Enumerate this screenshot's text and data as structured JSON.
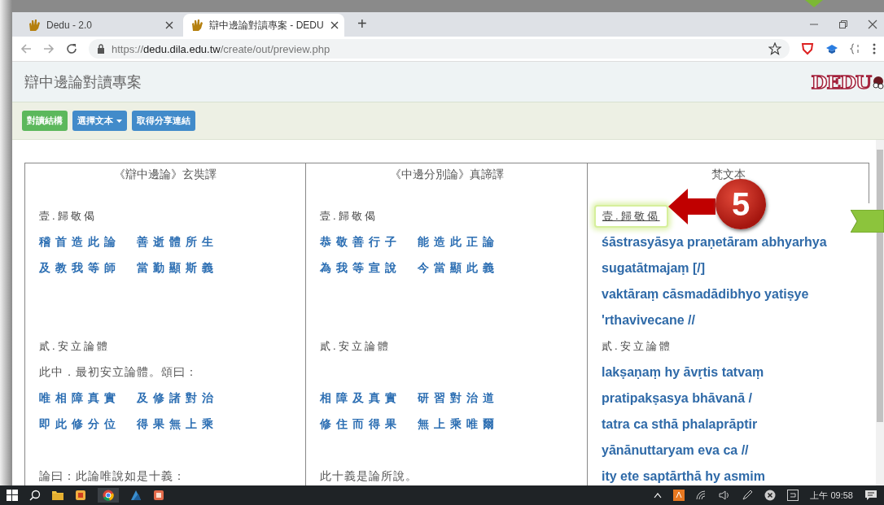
{
  "browser": {
    "tabs": [
      {
        "title": "Dedu - 2.0",
        "selected": false
      },
      {
        "title": "辯中邊論對讀專案 - DEDU",
        "selected": true
      }
    ],
    "new_tab": "+",
    "url": {
      "scheme": "https://",
      "host": "dedu.dila.edu.tw",
      "path": "/create/out/preview.php"
    }
  },
  "page": {
    "title": "辯中邊論對讀專案",
    "logo": "DEDU"
  },
  "toolbar": [
    {
      "label": "對讀結構",
      "kind": "success"
    },
    {
      "label": "選擇文本",
      "kind": "dropdown"
    },
    {
      "label": "取得分享連結",
      "kind": "primary"
    }
  ],
  "table": {
    "columns": [
      "《辯中邊論》玄奘譯",
      "《中邊分別論》真諦譯",
      "梵文本"
    ],
    "sections": [
      {
        "cells": [
          {
            "heading": {
              "text": "壹.歸敬偈",
              "highlighted": false
            },
            "lines": [
              {
                "kind": "verse",
                "text": "稽首造此論 善逝體所生"
              },
              {
                "kind": "verse",
                "text": "及教我等師 當勤顯斯義"
              }
            ]
          },
          {
            "heading": {
              "text": "壹.歸敬偈",
              "highlighted": false
            },
            "lines": [
              {
                "kind": "verse",
                "text": "恭敬善行子 能造此正論"
              },
              {
                "kind": "verse",
                "text": "為我等宣說 今當顯此義"
              }
            ]
          },
          {
            "heading": {
              "text": "壹.歸敬偈",
              "highlighted": true
            },
            "lines": [
              {
                "kind": "sanskrit",
                "text": "śāstrasyāsya praṇetāram abhyarhya"
              },
              {
                "kind": "sanskrit",
                "text": "sugatātmajaṃ [/]"
              },
              {
                "kind": "sanskrit",
                "text": "vaktāraṃ cāsmadādibhyo yatiṣye"
              },
              {
                "kind": "sanskrit",
                "text": "'rthavivecane //"
              }
            ]
          }
        ]
      },
      {
        "cells": [
          {
            "heading": {
              "text": "貳.安立論體",
              "highlighted": false
            },
            "lines": [
              {
                "kind": "prose",
                "text": "此中．最初安立論體。頌曰："
              },
              {
                "kind": "verse",
                "text": "唯相障真實 及修諸對治"
              },
              {
                "kind": "verse",
                "text": "即此修分位 得果無上乘"
              }
            ]
          },
          {
            "heading": {
              "text": "貳.安立論體",
              "highlighted": false
            },
            "lines": [
              {
                "kind": "gap"
              },
              {
                "kind": "verse",
                "text": "相障及真實 研習對治道"
              },
              {
                "kind": "verse",
                "text": "修住而得果 無上乘唯爾"
              }
            ]
          },
          {
            "heading": {
              "text": "貳.安立論體",
              "highlighted": false
            },
            "lines": [
              {
                "kind": "sanskrit",
                "text": "lakṣaṇaṃ hy āvṛtis tatvaṃ"
              },
              {
                "kind": "sanskrit",
                "text": "pratipakṣasya bhāvanā /"
              },
              {
                "kind": "sanskrit",
                "text": "tatra ca sthā phalaprāptir"
              },
              {
                "kind": "sanskrit",
                "text": "yānānuttaryam eva ca //"
              }
            ]
          }
        ]
      },
      {
        "cells": [
          {
            "lines": [
              {
                "kind": "prose",
                "text": "論曰：此論唯說如是十義："
              }
            ]
          },
          {
            "lines": [
              {
                "kind": "prose",
                "text": "此十義是論所說。"
              }
            ]
          },
          {
            "lines": [
              {
                "kind": "sanskrit",
                "text": "ity ete saptārthā hy asmim"
              }
            ]
          }
        ]
      }
    ]
  },
  "annotation": {
    "step": "5"
  },
  "taskbar": {
    "clock": "上午 09:58"
  }
}
